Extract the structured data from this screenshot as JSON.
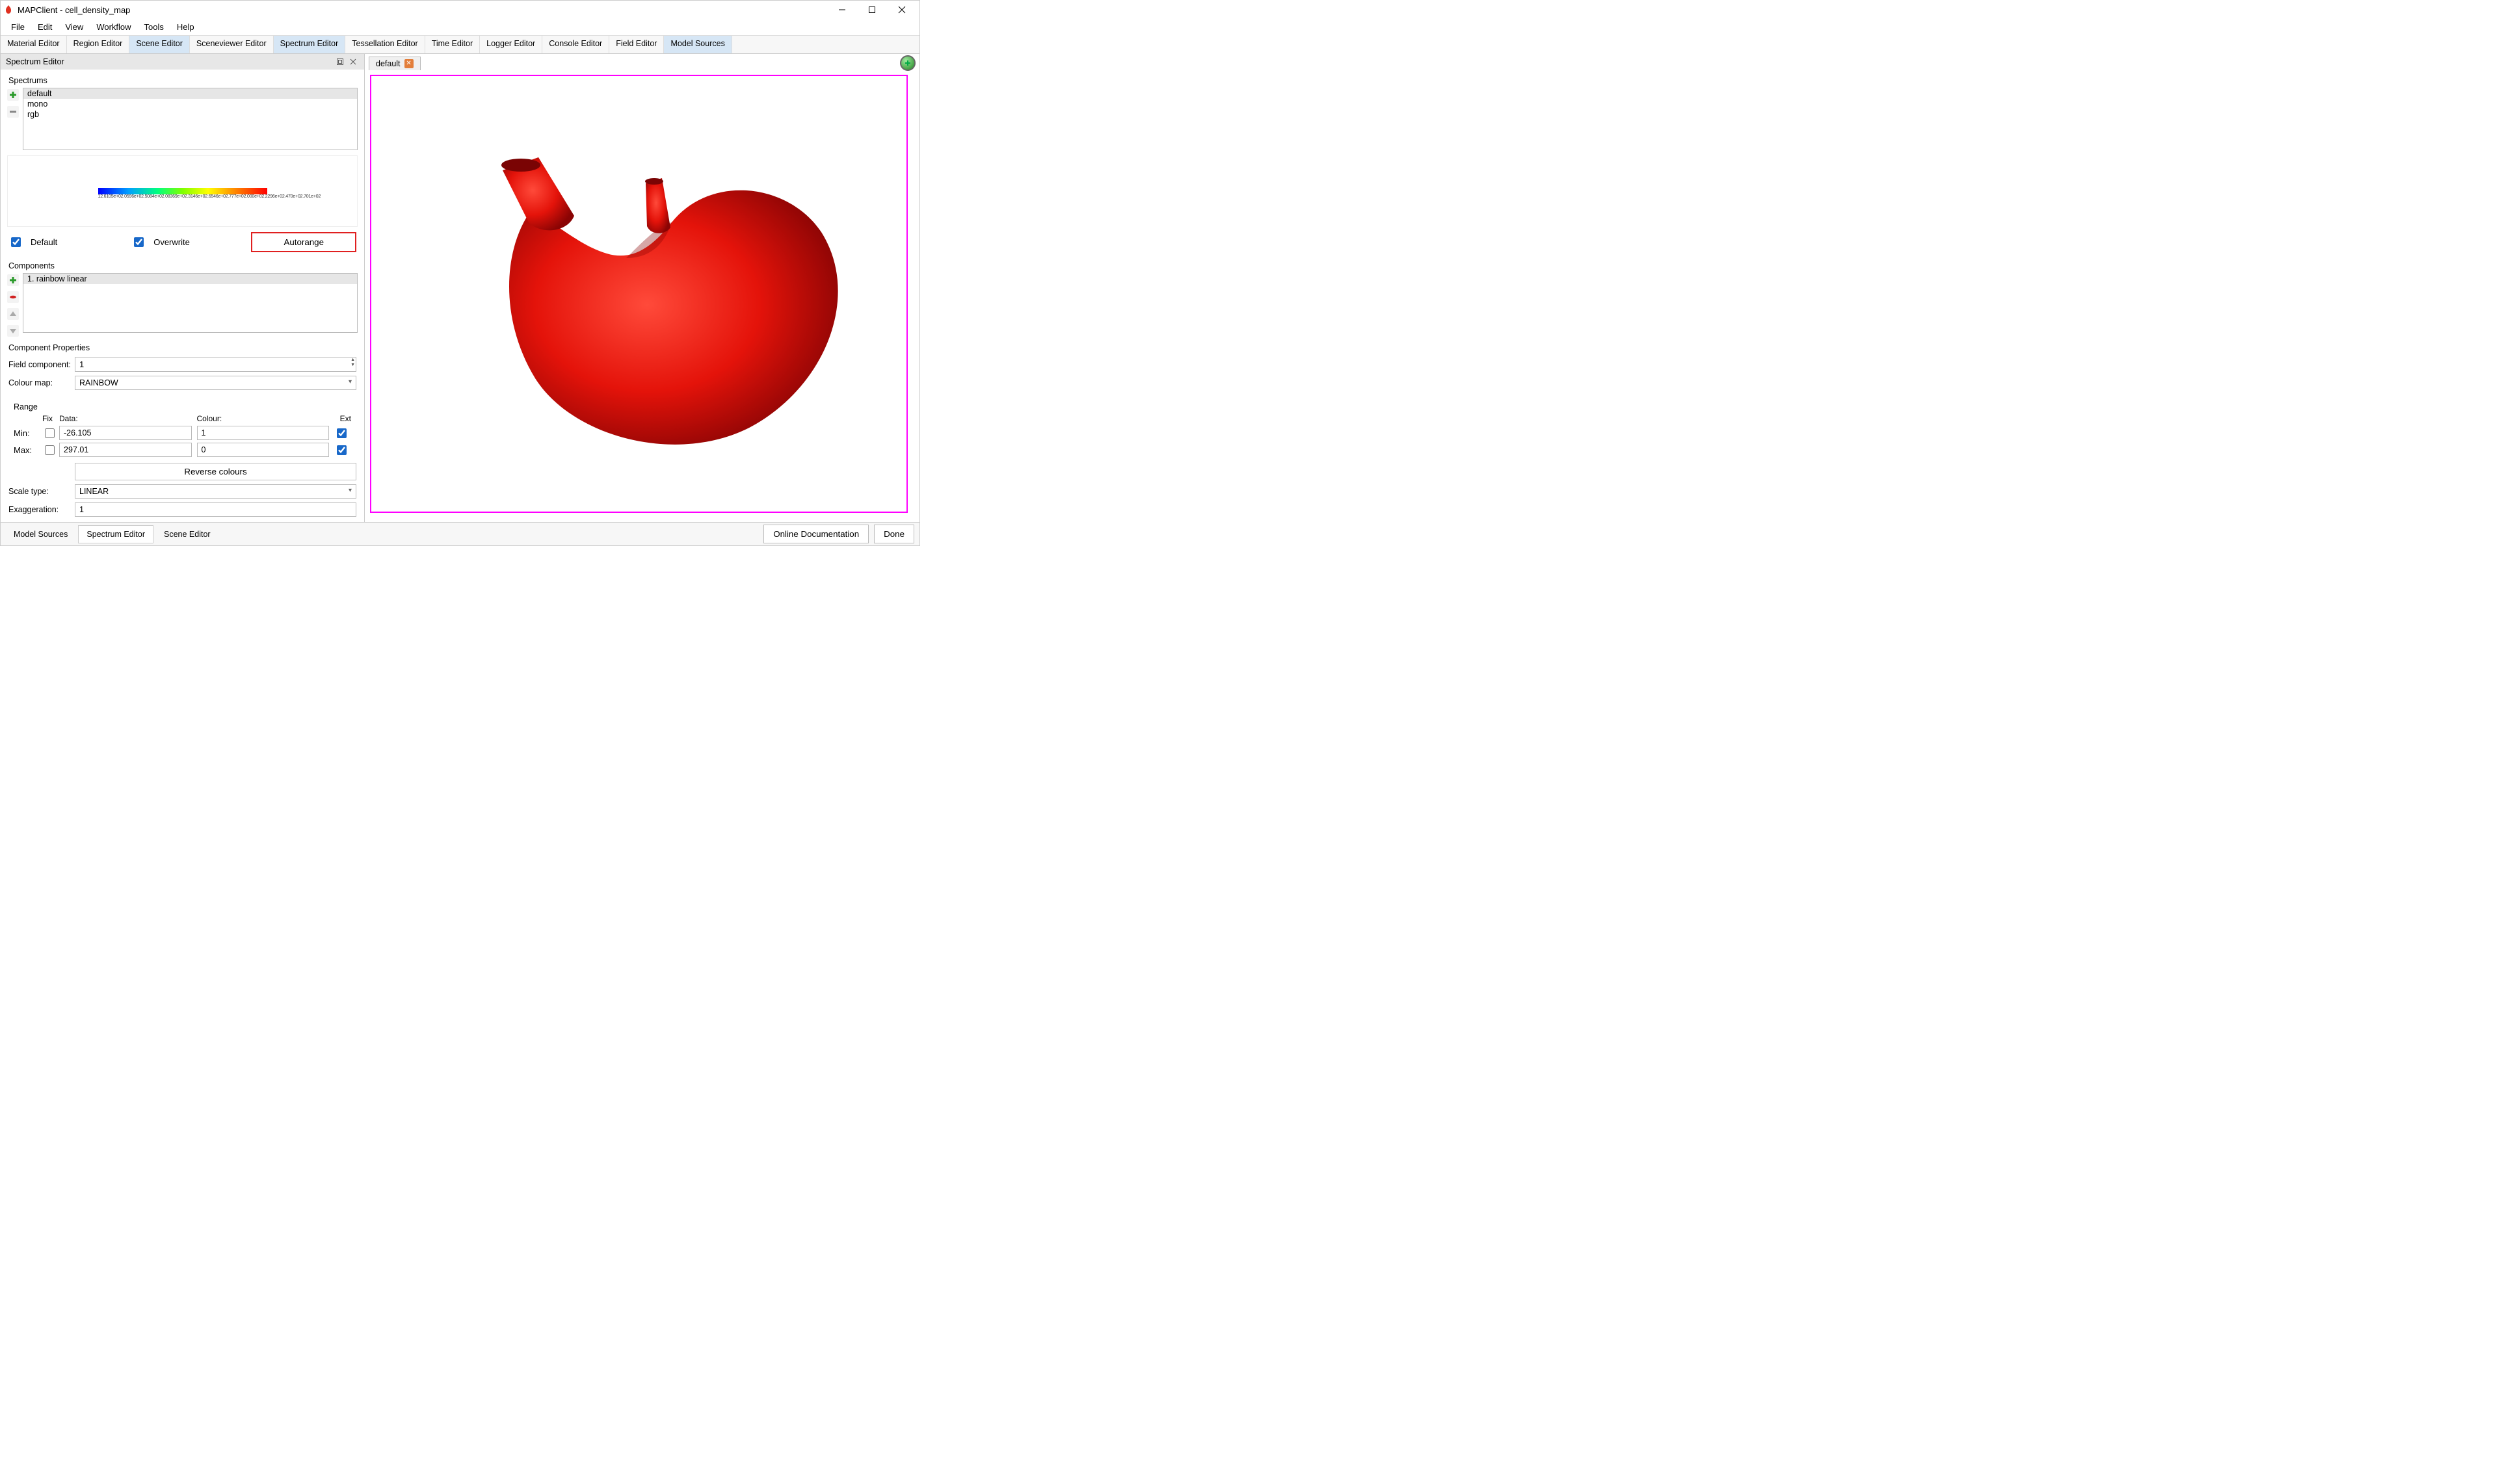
{
  "window": {
    "title": "MAPClient - cell_density_map"
  },
  "menu": {
    "items": [
      "File",
      "Edit",
      "View",
      "Workflow",
      "Tools",
      "Help"
    ]
  },
  "toolbar_tabs": {
    "items": [
      "Material Editor",
      "Region Editor",
      "Scene Editor",
      "Sceneviewer Editor",
      "Spectrum Editor",
      "Tessellation Editor",
      "Time Editor",
      "Logger Editor",
      "Console Editor",
      "Field Editor",
      "Model Sources"
    ],
    "active": [
      2,
      4,
      10
    ]
  },
  "panel": {
    "title": "Spectrum Editor"
  },
  "spectrums": {
    "label": "Spectrums",
    "items": [
      "default",
      "mono",
      "rgb"
    ],
    "selected_index": 0
  },
  "gradient": {
    "ticks_text": "12.6105e+02.0596e+02.5084e+02.08369e+02.3146e+02.6546e+02.777e+02.000e+02.2296e+02.470e+02.701e+02"
  },
  "checks": {
    "default_label": "Default",
    "overwrite_label": "Overwrite",
    "autorange_label": "Autorange"
  },
  "components": {
    "label": "Components",
    "items": [
      "1.  rainbow linear"
    ],
    "selected_index": 0
  },
  "component_properties": {
    "label": "Component Properties",
    "field_component_label": "Field component:",
    "field_component_value": "1",
    "colour_map_label": "Colour map:",
    "colour_map_value": "RAINBOW",
    "range_label": "Range",
    "fix_label": "Fix",
    "data_label": "Data:",
    "colour_label": "Colour:",
    "ext_label": "Ext",
    "min_label": "Min:",
    "min_data": "-26.105",
    "min_colour": "1",
    "max_label": "Max:",
    "max_data": "297.01",
    "max_colour": "0",
    "reverse_label": "Reverse colours",
    "scale_type_label": "Scale type:",
    "scale_type_value": "LINEAR",
    "exaggeration_label": "Exaggeration:",
    "exaggeration_value": "1"
  },
  "view": {
    "tab_label": "default"
  },
  "footer": {
    "tabs": [
      "Model Sources",
      "Spectrum Editor",
      "Scene Editor"
    ],
    "online_doc": "Online Documentation",
    "done": "Done"
  }
}
